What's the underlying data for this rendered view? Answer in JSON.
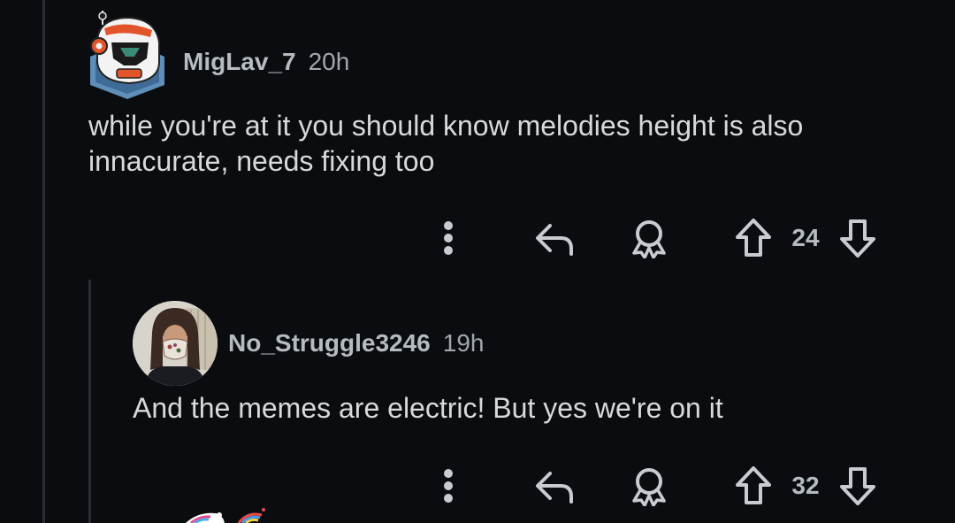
{
  "comments": [
    {
      "username": "MigLav_7",
      "time": "20h",
      "body": "while you're at it you should know melodies height is also innacurate, needs fixing too",
      "score": "24"
    },
    {
      "username": "No_Struggle3246",
      "time": "19h",
      "body": "And the memes are electric! But yes we're on it",
      "score": "32"
    }
  ],
  "icons": {
    "more": "more-vertical-icon",
    "reply": "reply-arrow-icon",
    "award": "award-icon",
    "upvote": "upvote-arrow-icon",
    "downvote": "downvote-arrow-icon"
  },
  "colors": {
    "background": "#0b0c10",
    "text": "#d7dadc",
    "muted": "#a0a7ad",
    "icon": "#c8ccd0"
  }
}
